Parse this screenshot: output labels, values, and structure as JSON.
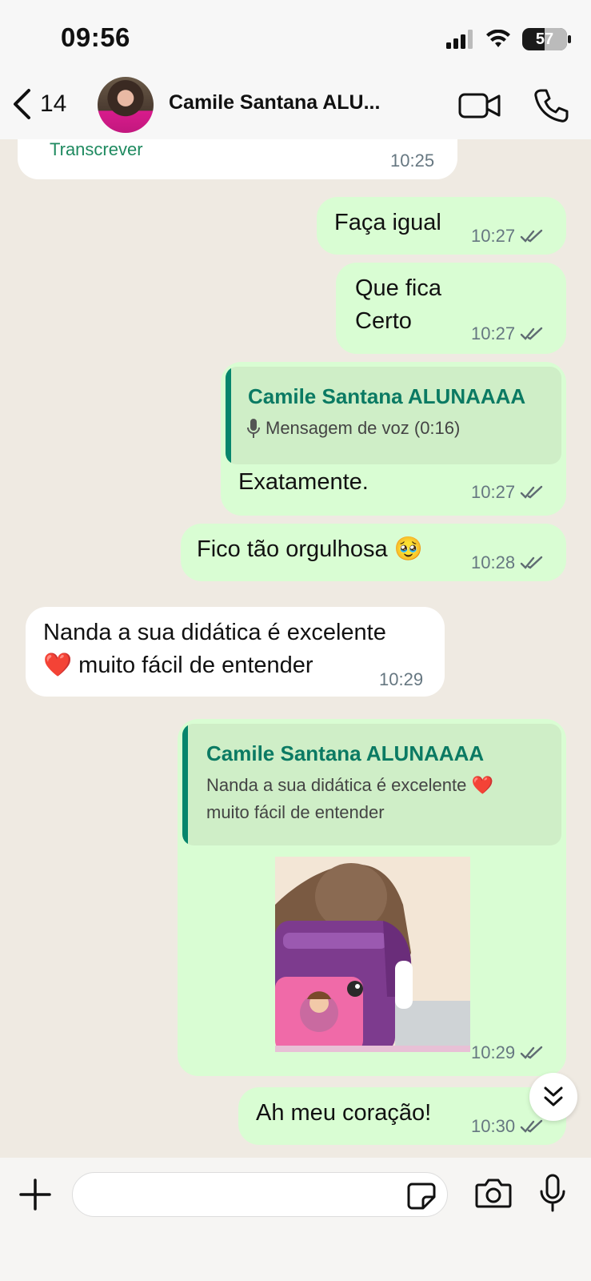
{
  "status_bar": {
    "time": "09:56",
    "battery": "57"
  },
  "header": {
    "back_count": "14",
    "contact_name": "Camile Santana ALU..."
  },
  "messages": {
    "m0": {
      "action": "Transcrever",
      "time": "10:25"
    },
    "m1": {
      "text": "Faça igual",
      "time": "10:27"
    },
    "m2": {
      "line1": "Que fica",
      "line2": "Certo",
      "time": "10:27"
    },
    "m3": {
      "quote_name": "Camile Santana ALUNAAAA",
      "quote_text": "Mensagem de voz (0:16)",
      "text": "Exatamente.",
      "time": "10:27"
    },
    "m4": {
      "text": "Fico tão orgulhosa 🥹",
      "time": "10:28"
    },
    "m5": {
      "line1": "Nanda a sua didática é excelente",
      "line2": "❤️ muito fácil de entender",
      "time": "10:29"
    },
    "m6": {
      "quote_name": "Camile Santana ALUNAAAA",
      "quote_line1": "Nanda a sua didática é excelente ❤️",
      "quote_line2": "muito fácil de entender",
      "time": "10:29"
    },
    "m7": {
      "text": "Ah meu coração!",
      "time": "10:30"
    }
  },
  "input": {
    "placeholder": ""
  },
  "colors": {
    "outgoing": "#d9fdd3",
    "incoming": "#ffffff",
    "background": "#efeae2",
    "accent": "#0b7a63"
  },
  "icons": [
    "back-chevron-icon",
    "video-call-icon",
    "phone-icon",
    "mic-icon",
    "double-check-icon",
    "scroll-down-icon",
    "plus-icon",
    "sticker-icon",
    "camera-icon"
  ]
}
